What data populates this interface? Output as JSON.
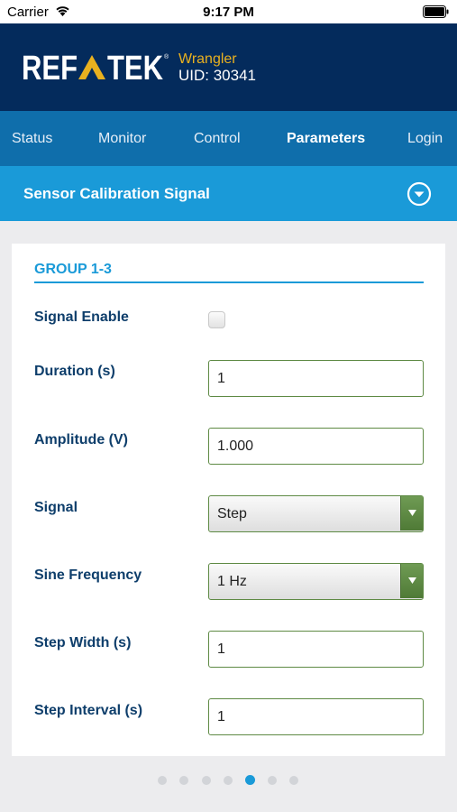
{
  "status_bar": {
    "carrier": "Carrier",
    "time": "9:17 PM"
  },
  "header": {
    "logo_text": "REFTEK",
    "device_name": "Wrangler",
    "device_uid": "UID: 30341",
    "brand_colors": {
      "navy": "#042b5c",
      "gold": "#e9b11f"
    }
  },
  "nav": {
    "items": [
      {
        "label": "Status"
      },
      {
        "label": "Monitor"
      },
      {
        "label": "Control"
      },
      {
        "label": "Parameters",
        "active": true
      },
      {
        "label": "Login"
      }
    ]
  },
  "section": {
    "title": "Sensor Calibration Signal",
    "toggle_icon": "chevron-down-circle-icon"
  },
  "group": {
    "title": "GROUP 1-3",
    "signal_enable": {
      "label": "Signal Enable",
      "checked": false
    },
    "duration": {
      "label": "Duration (s)",
      "value": "1"
    },
    "amplitude": {
      "label": "Amplitude (V)",
      "value": "1.000"
    },
    "signal": {
      "label": "Signal",
      "selected": "Step"
    },
    "sine_frequency": {
      "label": "Sine Frequency",
      "selected": "1 Hz"
    },
    "step_width": {
      "label": "Step Width (s)",
      "value": "1"
    },
    "step_interval": {
      "label": "Step Interval (s)",
      "value": "1"
    }
  },
  "pager": {
    "page_count": 7,
    "current_page": 5
  },
  "colors": {
    "accent": "#1a9ad8",
    "nav": "#0f6eab",
    "field_border": "#5e8a44",
    "label": "#0e3e6b"
  }
}
